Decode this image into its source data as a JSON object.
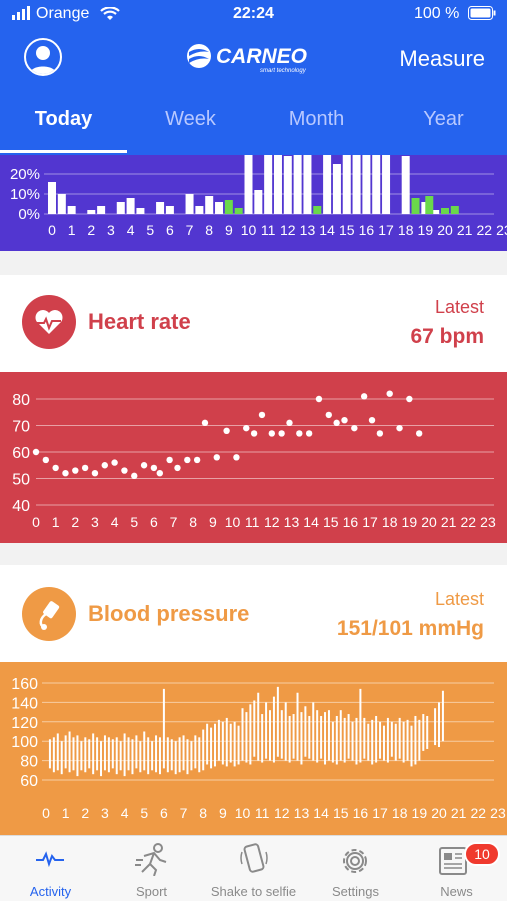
{
  "status_bar": {
    "carrier": "Orange",
    "time": "22:24",
    "battery": "100 %"
  },
  "topbar": {
    "logo_text": "CARNEO",
    "logo_sub": "smart technology",
    "measure_label": "Measure",
    "avatar_icon": "user-avatar-icon"
  },
  "tabs": [
    {
      "label": "Today",
      "active": true
    },
    {
      "label": "Week",
      "active": false
    },
    {
      "label": "Month",
      "active": false
    },
    {
      "label": "Year",
      "active": false
    }
  ],
  "colors": {
    "header": "#2563ee",
    "activity_bg": "#5236d0",
    "heart": "#d0404b",
    "bp": "#ef9a45",
    "green": "#6ad94b"
  },
  "chart_data": [
    {
      "type": "bar",
      "title": "",
      "yticks": [
        "0%",
        "10%",
        "20%"
      ],
      "ylim": [
        0,
        30
      ],
      "xlabels": [
        "0",
        "1",
        "2",
        "3",
        "4",
        "5",
        "6",
        "7",
        "8",
        "9",
        "10",
        "11",
        "12",
        "13",
        "14",
        "15",
        "16",
        "17",
        "18",
        "19",
        "20",
        "21",
        "22",
        "23"
      ],
      "series": [
        {
          "color": "#ffffff",
          "values": [
            [
              0,
              16
            ],
            [
              0.5,
              10
            ],
            [
              1,
              4
            ],
            [
              2,
              2
            ],
            [
              2.5,
              4
            ],
            [
              3.5,
              6
            ],
            [
              4,
              8
            ],
            [
              4.5,
              3
            ],
            [
              5.5,
              6
            ],
            [
              6,
              4
            ],
            [
              7,
              10
            ],
            [
              7.5,
              4
            ],
            [
              8,
              9
            ],
            [
              8.5,
              6
            ],
            [
              10,
              30
            ],
            [
              10.5,
              12
            ],
            [
              11,
              30
            ],
            [
              11.5,
              30
            ],
            [
              12,
              29
            ],
            [
              12.5,
              30
            ],
            [
              13,
              30
            ],
            [
              14,
              30
            ],
            [
              14.5,
              25
            ],
            [
              15,
              30
            ],
            [
              15.5,
              30
            ],
            [
              16,
              30
            ],
            [
              16.5,
              30
            ],
            [
              17,
              30
            ],
            [
              18,
              29
            ],
            [
              19,
              6
            ],
            [
              19.5,
              2
            ]
          ]
        },
        {
          "color": "#6ad94b",
          "values": [
            [
              9,
              7
            ],
            [
              9.5,
              3
            ],
            [
              13.5,
              4
            ],
            [
              18.5,
              8
            ],
            [
              19.2,
              9
            ],
            [
              20,
              3
            ],
            [
              20.5,
              4
            ]
          ]
        }
      ]
    },
    {
      "type": "scatter",
      "title": "Heart rate",
      "ylim": [
        40,
        85
      ],
      "yticks": [
        40,
        50,
        60,
        70,
        80
      ],
      "xlabels": [
        "0",
        "1",
        "2",
        "3",
        "4",
        "5",
        "6",
        "7",
        "8",
        "9",
        "10",
        "11",
        "12",
        "13",
        "14",
        "15",
        "16",
        "17",
        "18",
        "19",
        "20",
        "21",
        "22",
        "23"
      ],
      "points": [
        [
          0,
          60
        ],
        [
          0.5,
          57
        ],
        [
          1,
          54
        ],
        [
          1.5,
          52
        ],
        [
          2,
          53
        ],
        [
          2.5,
          54
        ],
        [
          3,
          52
        ],
        [
          3.5,
          55
        ],
        [
          4,
          56
        ],
        [
          4.5,
          53
        ],
        [
          5,
          51
        ],
        [
          5.5,
          55
        ],
        [
          6,
          54
        ],
        [
          6.3,
          52
        ],
        [
          6.8,
          57
        ],
        [
          7.2,
          54
        ],
        [
          7.7,
          57
        ],
        [
          8.2,
          57
        ],
        [
          8.6,
          71
        ],
        [
          9.2,
          58
        ],
        [
          9.7,
          68
        ],
        [
          10.2,
          58
        ],
        [
          10.7,
          69
        ],
        [
          11.1,
          67
        ],
        [
          11.5,
          74
        ],
        [
          12,
          67
        ],
        [
          12.5,
          67
        ],
        [
          12.9,
          71
        ],
        [
          13.4,
          67
        ],
        [
          13.9,
          67
        ],
        [
          14.4,
          80
        ],
        [
          14.9,
          74
        ],
        [
          15.3,
          71
        ],
        [
          15.7,
          72
        ],
        [
          16.2,
          69
        ],
        [
          16.7,
          81
        ],
        [
          17.1,
          72
        ],
        [
          17.5,
          67
        ],
        [
          18,
          82
        ],
        [
          18.5,
          69
        ],
        [
          19,
          80
        ],
        [
          19.5,
          67
        ]
      ]
    },
    {
      "type": "bar",
      "title": "Blood pressure",
      "ylim": [
        60,
        165
      ],
      "yticks": [
        60,
        80,
        100,
        120,
        140,
        160
      ],
      "xlabels": [
        "0",
        "1",
        "2",
        "3",
        "4",
        "5",
        "6",
        "7",
        "8",
        "9",
        "10",
        "11",
        "12",
        "13",
        "14",
        "15",
        "16",
        "17",
        "18",
        "19",
        "20",
        "21",
        "22",
        "23"
      ],
      "ranges": [
        [
          0.2,
          72,
          102
        ],
        [
          0.4,
          68,
          104
        ],
        [
          0.6,
          70,
          108
        ],
        [
          0.8,
          66,
          100
        ],
        [
          1.0,
          72,
          106
        ],
        [
          1.2,
          68,
          110
        ],
        [
          1.4,
          70,
          104
        ],
        [
          1.6,
          64,
          106
        ],
        [
          1.8,
          70,
          100
        ],
        [
          2.0,
          68,
          104
        ],
        [
          2.2,
          72,
          102
        ],
        [
          2.4,
          66,
          108
        ],
        [
          2.6,
          70,
          104
        ],
        [
          2.8,
          64,
          100
        ],
        [
          3.0,
          70,
          106
        ],
        [
          3.2,
          68,
          104
        ],
        [
          3.4,
          72,
          102
        ],
        [
          3.6,
          66,
          104
        ],
        [
          3.8,
          70,
          100
        ],
        [
          4.0,
          64,
          108
        ],
        [
          4.2,
          70,
          104
        ],
        [
          4.4,
          66,
          102
        ],
        [
          4.6,
          72,
          106
        ],
        [
          4.8,
          68,
          100
        ],
        [
          5.0,
          70,
          110
        ],
        [
          5.2,
          66,
          104
        ],
        [
          5.4,
          70,
          100
        ],
        [
          5.6,
          68,
          106
        ],
        [
          5.8,
          66,
          104
        ],
        [
          6.0,
          72,
          154
        ],
        [
          6.2,
          68,
          104
        ],
        [
          6.4,
          70,
          102
        ],
        [
          6.6,
          66,
          100
        ],
        [
          6.8,
          68,
          104
        ],
        [
          7.0,
          70,
          106
        ],
        [
          7.2,
          66,
          102
        ],
        [
          7.4,
          70,
          100
        ],
        [
          7.6,
          72,
          106
        ],
        [
          7.8,
          68,
          104
        ],
        [
          8.0,
          70,
          112
        ],
        [
          8.2,
          76,
          118
        ],
        [
          8.4,
          72,
          114
        ],
        [
          8.6,
          74,
          118
        ],
        [
          8.8,
          80,
          122
        ],
        [
          9.0,
          76,
          120
        ],
        [
          9.2,
          74,
          124
        ],
        [
          9.4,
          78,
          118
        ],
        [
          9.6,
          74,
          120
        ],
        [
          9.8,
          76,
          116
        ],
        [
          10.0,
          80,
          134
        ],
        [
          10.2,
          78,
          130
        ],
        [
          10.4,
          76,
          138
        ],
        [
          10.6,
          84,
          142
        ],
        [
          10.8,
          80,
          150
        ],
        [
          11.0,
          78,
          128
        ],
        [
          11.2,
          82,
          140
        ],
        [
          11.4,
          80,
          132
        ],
        [
          11.6,
          78,
          146
        ],
        [
          11.8,
          84,
          156
        ],
        [
          12.0,
          82,
          132
        ],
        [
          12.2,
          80,
          140
        ],
        [
          12.4,
          78,
          126
        ],
        [
          12.6,
          82,
          128
        ],
        [
          12.8,
          80,
          150
        ],
        [
          13.0,
          76,
          130
        ],
        [
          13.2,
          84,
          136
        ],
        [
          13.4,
          82,
          126
        ],
        [
          13.6,
          80,
          140
        ],
        [
          13.8,
          78,
          132
        ],
        [
          14.0,
          82,
          126
        ],
        [
          14.2,
          76,
          130
        ],
        [
          14.4,
          80,
          132
        ],
        [
          14.6,
          78,
          120
        ],
        [
          14.8,
          76,
          126
        ],
        [
          15.0,
          80,
          132
        ],
        [
          15.2,
          78,
          124
        ],
        [
          15.4,
          82,
          128
        ],
        [
          15.6,
          80,
          120
        ],
        [
          15.8,
          76,
          124
        ],
        [
          16.0,
          78,
          154
        ],
        [
          16.2,
          82,
          124
        ],
        [
          16.4,
          80,
          118
        ],
        [
          16.6,
          76,
          122
        ],
        [
          16.8,
          78,
          126
        ],
        [
          17.0,
          82,
          120
        ],
        [
          17.2,
          80,
          116
        ],
        [
          17.4,
          78,
          124
        ],
        [
          17.6,
          84,
          120
        ],
        [
          17.8,
          80,
          118
        ],
        [
          18.0,
          82,
          124
        ],
        [
          18.2,
          78,
          120
        ],
        [
          18.4,
          80,
          122
        ],
        [
          18.6,
          74,
          116
        ],
        [
          18.8,
          76,
          126
        ],
        [
          19.0,
          80,
          122
        ],
        [
          19.2,
          90,
          128
        ],
        [
          19.4,
          92,
          126
        ],
        [
          19.8,
          96,
          134
        ],
        [
          20.0,
          94,
          140
        ],
        [
          20.2,
          100,
          152
        ]
      ]
    }
  ],
  "heart_card": {
    "title": "Heart rate",
    "latest_label": "Latest",
    "latest_value": "67 bpm",
    "icon": "heart-pulse-icon"
  },
  "bp_card": {
    "title": "Blood pressure",
    "latest_label": "Latest",
    "latest_value": "151/101 mmHg",
    "icon": "bp-cuff-icon"
  },
  "tabbar": [
    {
      "label": "Activity",
      "icon": "activity-pulse-icon",
      "active": true
    },
    {
      "label": "Sport",
      "icon": "runner-icon",
      "active": false
    },
    {
      "label": "Shake to selfie",
      "icon": "phone-shake-icon",
      "active": false
    },
    {
      "label": "Settings",
      "icon": "gear-icon",
      "active": false
    },
    {
      "label": "News",
      "icon": "newspaper-icon",
      "active": false,
      "badge": "10"
    }
  ]
}
